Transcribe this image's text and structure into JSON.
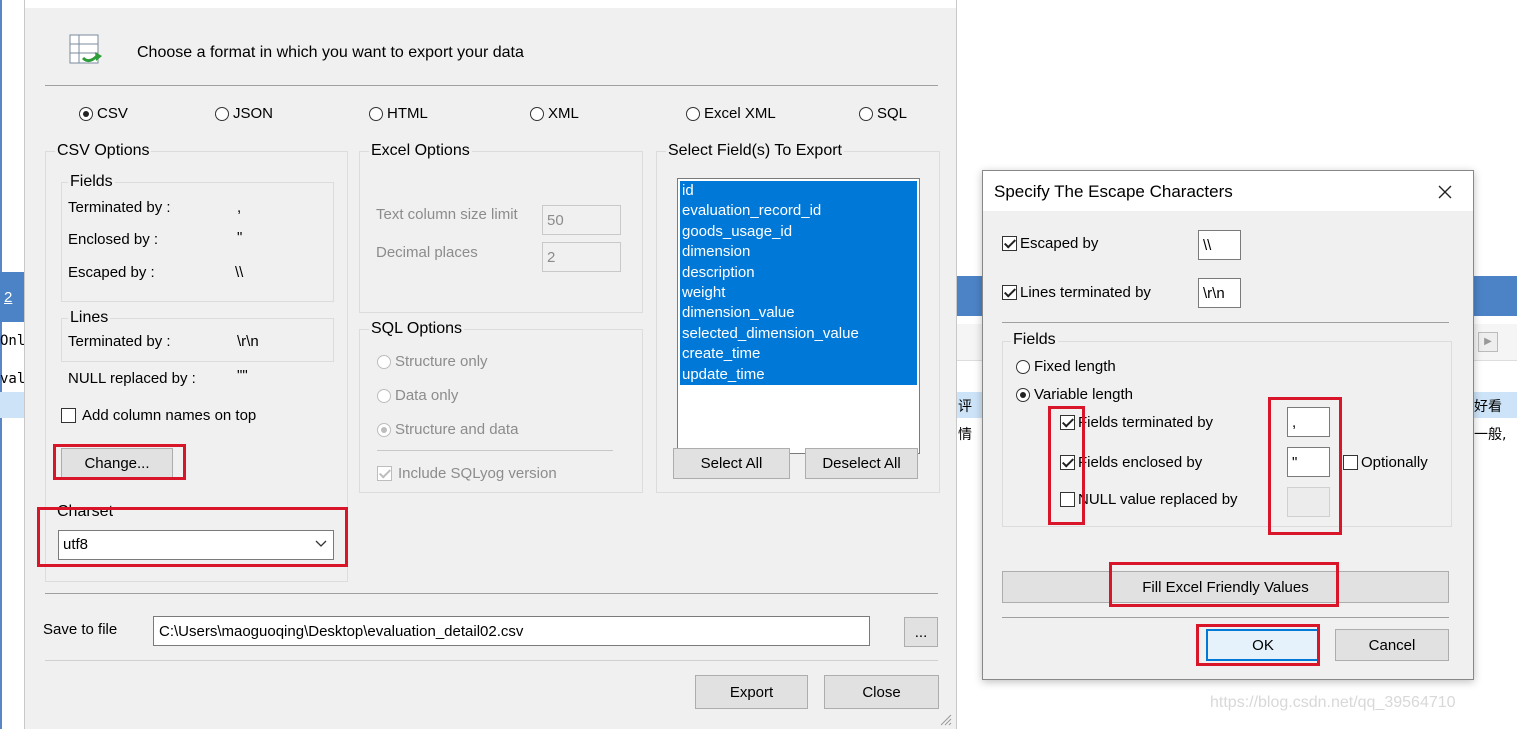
{
  "background": {
    "tab_number": "2",
    "left_code_1": "Onl",
    "left_code_2": "val",
    "right_text_1": "评",
    "right_text_2": "情",
    "right_text_3": "好看",
    "right_text_4": "一般,",
    "watermark": "https://blog.csdn.net/qq_39564710"
  },
  "export_dialog": {
    "header_text": "Choose a format in which you want to export your data",
    "formats": [
      {
        "label": "CSV",
        "selected": true
      },
      {
        "label": "JSON",
        "selected": false
      },
      {
        "label": "HTML",
        "selected": false
      },
      {
        "label": "XML",
        "selected": false
      },
      {
        "label": "Excel  XML",
        "selected": false
      },
      {
        "label": "SQL",
        "selected": false
      }
    ],
    "csv_options": {
      "title": "CSV Options",
      "fields_title": "Fields",
      "terminated_label": "Terminated by :",
      "terminated_value": ",",
      "enclosed_label": "Enclosed by :",
      "enclosed_value": "\"",
      "escaped_label": "Escaped by :",
      "escaped_value": "\\\\",
      "lines_title": "Lines",
      "lines_terminated_label": "Terminated by :",
      "lines_terminated_value": "\\r\\n",
      "null_label": "NULL replaced by :",
      "null_value": "\"\"",
      "add_column_names": "Add column names on top",
      "change_button": "Change..."
    },
    "charset": {
      "title": "Charset",
      "value": "utf8"
    },
    "excel_options": {
      "title": "Excel Options",
      "text_limit_label": "Text column size limit",
      "text_limit_value": "50",
      "decimal_label": "Decimal places",
      "decimal_value": "2"
    },
    "sql_options": {
      "title": "SQL Options",
      "structure_only": "Structure only",
      "data_only": "Data only",
      "structure_and_data": "Structure and data",
      "include_version": "Include SQLyog version"
    },
    "select_fields": {
      "title": "Select Field(s) To Export",
      "fields": [
        "id",
        "evaluation_record_id",
        "goods_usage_id",
        "dimension",
        "description",
        "weight",
        "dimension_value",
        "selected_dimension_value",
        "create_time",
        "update_time"
      ],
      "select_all": "Select All",
      "deselect_all": "Deselect All"
    },
    "save_to_file_label": "Save to file",
    "save_path": "C:\\Users\\maoguoqing\\Desktop\\evaluation_detail02.csv",
    "browse_button": "...",
    "export_button": "Export",
    "close_button": "Close"
  },
  "escape_dialog": {
    "title": "Specify The Escape Characters",
    "escaped_by_label": "Escaped by",
    "escaped_by_value": "\\\\",
    "lines_terminated_label": "Lines terminated by",
    "lines_terminated_value": "\\r\\n",
    "fields_title": "Fields",
    "fixed_length": "Fixed length",
    "variable_length": "Variable length",
    "fields_terminated_label": "Fields terminated by",
    "fields_terminated_value": ",",
    "fields_enclosed_label": "Fields enclosed by",
    "fields_enclosed_value": "\"",
    "optionally_label": "Optionally",
    "null_replaced_label": "NULL value replaced by",
    "fill_excel_button": "Fill Excel Friendly Values",
    "ok_button": "OK",
    "cancel_button": "Cancel"
  },
  "colors": {
    "dialog_bg": "#f0f0f0",
    "selection_blue": "#0078d7",
    "highlight_red": "#d9152a",
    "app_bar_blue": "#4c83c7"
  }
}
